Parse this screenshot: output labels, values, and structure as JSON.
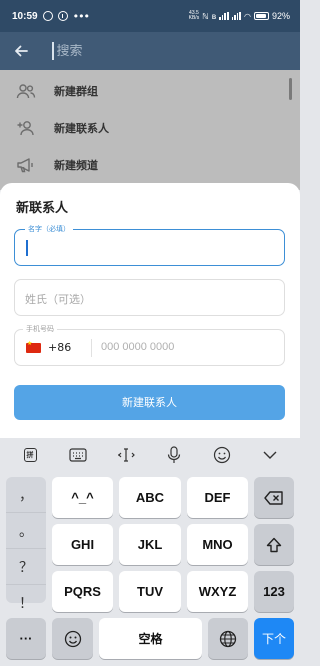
{
  "status_bar": {
    "time": "10:59",
    "net_speed_value": "43.5",
    "net_speed_unit": "KB/s",
    "battery_level": 0.92,
    "battery_text": "92%"
  },
  "search": {
    "placeholder": "搜索"
  },
  "menu": {
    "items": [
      {
        "label": "新建群组",
        "icon": "group-icon"
      },
      {
        "label": "新建联系人",
        "icon": "add-person-icon"
      },
      {
        "label": "新建频道",
        "icon": "megaphone-icon"
      }
    ]
  },
  "sheet": {
    "title": "新联系人",
    "first_name_label": "名字（必填）",
    "last_name_placeholder": "姓氏（可选）",
    "phone_label": "手机号码",
    "country_code": "+86",
    "phone_placeholder": "000 0000 0000",
    "create_button": "新建联系人"
  },
  "keyboard": {
    "toolbar": [
      {
        "icon": "ime-switch-icon",
        "label": "拼"
      },
      {
        "icon": "keyboard-icon"
      },
      {
        "icon": "text-cursor-icon"
      },
      {
        "icon": "microphone-icon"
      },
      {
        "icon": "emoji-icon"
      },
      {
        "icon": "collapse-icon"
      }
    ],
    "side_keys": [
      "，",
      "。",
      "？",
      "！"
    ],
    "row1": [
      "^_^",
      "ABC",
      "DEF"
    ],
    "row2": [
      "GHI",
      "JKL",
      "MNO"
    ],
    "row3": [
      "PQRS",
      "TUV",
      "WXYZ"
    ],
    "symbols_key": "···",
    "numbers_key": "123",
    "space_key": "空格",
    "next_key": "下个"
  },
  "colors": {
    "status_bar": "#2f4a66",
    "accent": "#3d8fd6",
    "button": "#54a4e6",
    "keyboard_action": "#1e88f5"
  }
}
